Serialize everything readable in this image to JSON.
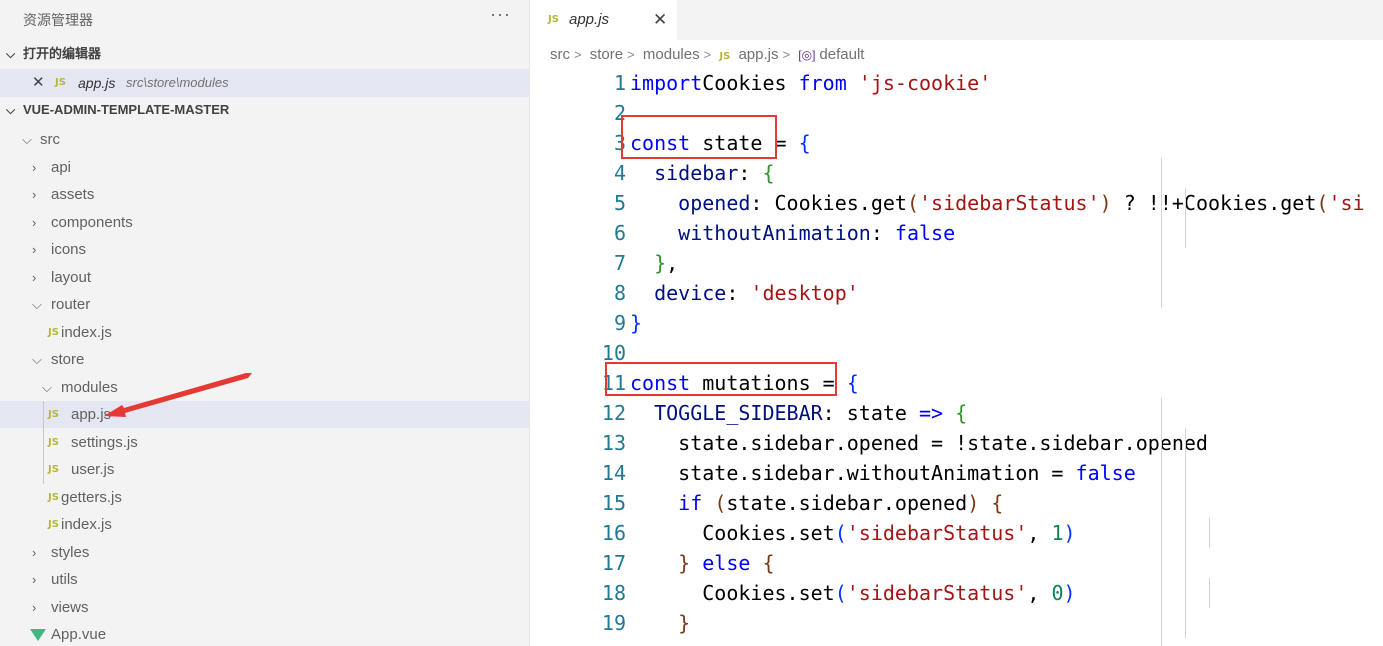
{
  "sidebar": {
    "title": "资源管理器",
    "more": "···",
    "open_editors": {
      "header": "打开的编辑器",
      "item": {
        "close": "✕",
        "icon_text": "JS",
        "name": "app.js",
        "path": "src\\store\\modules"
      }
    },
    "project": {
      "header": "VUE-ADMIN-TEMPLATE-MASTER",
      "tree": [
        {
          "label": "src",
          "type": "folder",
          "expanded": true,
          "depth": 0
        },
        {
          "label": "api",
          "type": "folder",
          "expanded": false,
          "depth": 1
        },
        {
          "label": "assets",
          "type": "folder",
          "expanded": false,
          "depth": 1
        },
        {
          "label": "components",
          "type": "folder",
          "expanded": false,
          "depth": 1
        },
        {
          "label": "icons",
          "type": "folder",
          "expanded": false,
          "depth": 1
        },
        {
          "label": "layout",
          "type": "folder",
          "expanded": false,
          "depth": 1
        },
        {
          "label": "router",
          "type": "folder",
          "expanded": true,
          "depth": 1
        },
        {
          "label": "index.js",
          "type": "js",
          "depth": 2
        },
        {
          "label": "store",
          "type": "folder",
          "expanded": true,
          "depth": 1
        },
        {
          "label": "modules",
          "type": "folder",
          "expanded": true,
          "depth": 2
        },
        {
          "label": "app.js",
          "type": "js",
          "depth": 3,
          "selected": true
        },
        {
          "label": "settings.js",
          "type": "js",
          "depth": 3
        },
        {
          "label": "user.js",
          "type": "js",
          "depth": 3
        },
        {
          "label": "getters.js",
          "type": "js",
          "depth": 2
        },
        {
          "label": "index.js",
          "type": "js",
          "depth": 2
        },
        {
          "label": "styles",
          "type": "folder",
          "expanded": false,
          "depth": 1
        },
        {
          "label": "utils",
          "type": "folder",
          "expanded": false,
          "depth": 1
        },
        {
          "label": "views",
          "type": "folder",
          "expanded": false,
          "depth": 1
        },
        {
          "label": "App.vue",
          "type": "vue",
          "depth": 1
        }
      ]
    }
  },
  "editor": {
    "tab": {
      "icon_text": "JS",
      "name": "app.js",
      "close": "✕"
    },
    "breadcrumb": [
      "src",
      "modules",
      "app.js",
      "default"
    ],
    "breadcrumb_store": "store",
    "lines": [
      [
        [
          "kw",
          "import"
        ],
        [
          "",
          "Cookies "
        ],
        [
          "kw",
          "from"
        ],
        [
          "",
          ""
        ],
        [
          "str",
          "'js-cookie'"
        ]
      ],
      [],
      [
        [
          "kw",
          "const"
        ],
        [
          "",
          " state = "
        ],
        [
          "b1",
          "{"
        ]
      ],
      [
        [
          "",
          " "
        ],
        [
          "prop",
          "sidebar"
        ],
        [
          "",
          ": "
        ],
        [
          "b2",
          "{"
        ]
      ],
      [
        [
          "",
          "  "
        ],
        [
          "prop",
          "opened"
        ],
        [
          "",
          ": Cookies.get"
        ],
        [
          "b3",
          "("
        ],
        [
          "str",
          "'sidebarStatus'"
        ],
        [
          "b3",
          ")"
        ],
        [
          "",
          " ? !!+Cookies.get"
        ],
        [
          "b3",
          "("
        ],
        [
          "str",
          "'si"
        ]
      ],
      [
        [
          "",
          "  "
        ],
        [
          "prop",
          "withoutAnimation"
        ],
        [
          "",
          ": "
        ],
        [
          "kw",
          "false"
        ]
      ],
      [
        [
          "",
          " "
        ],
        [
          "b2",
          "}"
        ],
        [
          "",
          ","
        ]
      ],
      [
        [
          "",
          " "
        ],
        [
          "prop",
          "device"
        ],
        [
          "",
          ": "
        ],
        [
          "str",
          "'desktop'"
        ]
      ],
      [
        [
          "b1",
          "}"
        ]
      ],
      [],
      [
        [
          "kw",
          "const"
        ],
        [
          "",
          " mutations = "
        ],
        [
          "b1",
          "{"
        ]
      ],
      [
        [
          "",
          " "
        ],
        [
          "prop",
          "TOGGLE_SIDEBAR"
        ],
        [
          "",
          ": state "
        ],
        [
          "kw",
          "=>"
        ],
        [
          "",
          " "
        ],
        [
          "b2",
          "{"
        ]
      ],
      [
        [
          "",
          "  state.sidebar.opened = !state.sidebar.opened"
        ]
      ],
      [
        [
          "",
          "  state.sidebar.withoutAnimation = "
        ],
        [
          "kw",
          "false"
        ]
      ],
      [
        [
          "",
          "  "
        ],
        [
          "kw",
          "if"
        ],
        [
          "",
          " "
        ],
        [
          "b3",
          "("
        ],
        [
          "",
          "state.sidebar.opened"
        ],
        [
          "b3",
          ")"
        ],
        [
          "",
          " "
        ],
        [
          "b3",
          "{"
        ]
      ],
      [
        [
          "",
          "   Cookies.set"
        ],
        [
          "b1",
          "("
        ],
        [
          "str",
          "'sidebarStatus'"
        ],
        [
          "",
          ", "
        ],
        [
          "num",
          "1"
        ],
        [
          "b1",
          ")"
        ]
      ],
      [
        [
          "",
          "  "
        ],
        [
          "b3",
          "}"
        ],
        [
          "",
          " "
        ],
        [
          "kw",
          "else"
        ],
        [
          "",
          " "
        ],
        [
          "b3",
          "{"
        ]
      ],
      [
        [
          "",
          "   Cookies.set"
        ],
        [
          "b1",
          "("
        ],
        [
          "str",
          "'sidebarStatus'"
        ],
        [
          "",
          ", "
        ],
        [
          "num",
          "0"
        ],
        [
          "b1",
          ")"
        ]
      ],
      [
        [
          "",
          "  "
        ],
        [
          "b3",
          "}"
        ]
      ]
    ]
  }
}
